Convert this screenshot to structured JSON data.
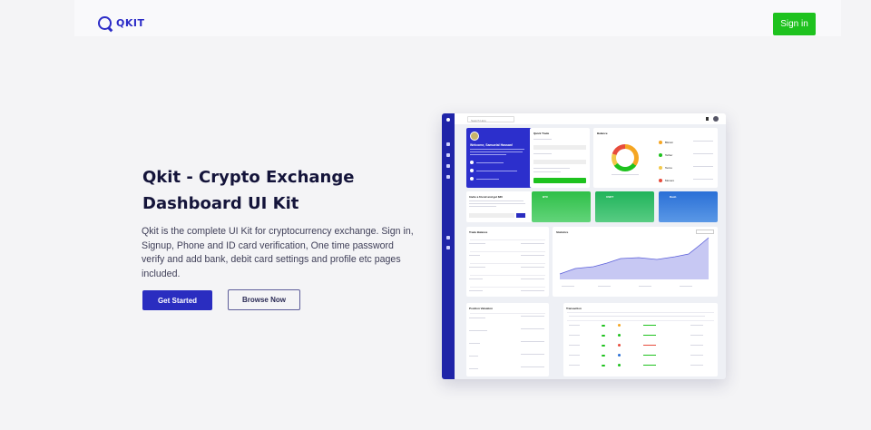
{
  "header": {
    "logo_text": "QKIT",
    "signin_label": "Sign in"
  },
  "hero": {
    "title": "Qkit - Crypto Exchange Dashboard UI Kit",
    "description": "Qkit is the complete UI Kit for cryptocurrency exchange. Sign in, Signup, Phone and ID card verification, One time password verify and add bank, debit card settings and profile etc pages included.",
    "get_started_label": "Get Started",
    "browse_now_label": "Browse Now"
  },
  "mockup": {
    "search_placeholder": "Search Here",
    "welcome_title": "Welcome, Samuelal Hassan!",
    "quick_trade": "Quick Trade",
    "balance": "Balance",
    "refer_title": "Invite a friend and get $30",
    "trade_balance": "Trade Balance",
    "statistics": "Statistics",
    "position_valuation": "Position Valuation",
    "transaction": "Transaction",
    "coins": [
      "Bitcoin",
      "Tether",
      "Tezos",
      "Monero"
    ],
    "wallets": [
      "BTC",
      "USDT",
      "Dash"
    ],
    "colors": {
      "primary": "#2a2dc0",
      "green": "#1ec21e",
      "blue": "#2a6fd6",
      "bitcoin": "#f5a623",
      "tezos": "#f2c94c",
      "monero": "#e74c3c"
    }
  }
}
